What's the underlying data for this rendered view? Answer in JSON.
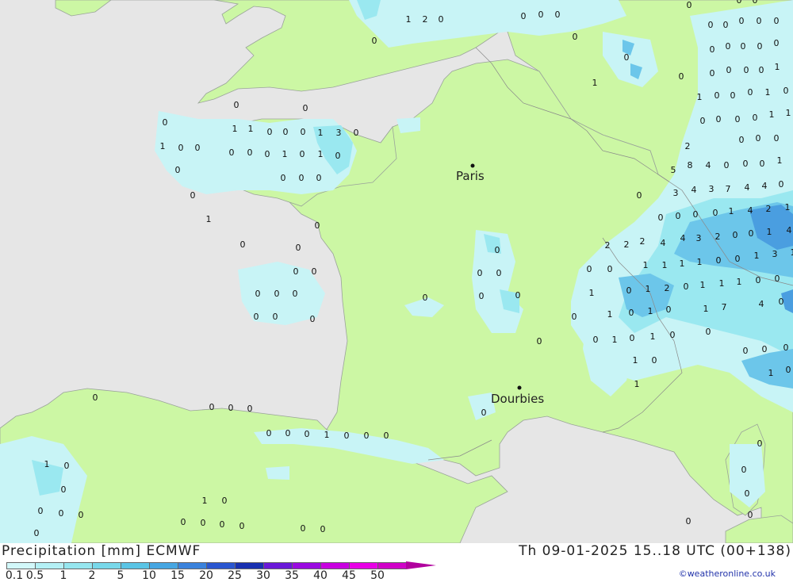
{
  "map": {
    "colors": {
      "sea": "#e6e6e6",
      "land": "#ccf7a4",
      "precip_light": "#c8f4f6",
      "precip_mid": "#9ae8f0",
      "precip_heavy": "#6cc6ea",
      "precip_very_heavy": "#4a9ee0"
    },
    "cities": [
      {
        "name": "Paris"
      },
      {
        "name": "Dourbies"
      }
    ],
    "values": [
      "1",
      "2",
      "0",
      "0",
      "0",
      "0",
      "0",
      "0",
      "1",
      "1",
      "0",
      "0",
      "0",
      "1",
      "3",
      "0",
      "0",
      "0",
      "0",
      "1",
      "0",
      "0",
      "0",
      "0",
      "0",
      "1",
      "0",
      "1",
      "0",
      "0",
      "0",
      "0",
      "0",
      "0",
      "1",
      "0",
      "0",
      "0",
      "0",
      "0",
      "0",
      "0",
      "0",
      "0",
      "0",
      "0",
      "0",
      "0",
      "0",
      "0",
      "0",
      "0",
      "0",
      "0",
      "0",
      "0",
      "0",
      "0",
      "0",
      "0",
      "0",
      "1",
      "0",
      "0",
      "0",
      "1",
      "0",
      "0",
      "0",
      "0",
      "0",
      "1",
      "0",
      "0",
      "0",
      "0",
      "0",
      "0",
      "0",
      "0",
      "0",
      "0",
      "0",
      "0",
      "0",
      "0",
      "0",
      "0",
      "0",
      "0",
      "0",
      "0",
      "0",
      "0",
      "0",
      "0",
      "0",
      "0",
      "0",
      "0",
      "0",
      "0",
      "1",
      "1",
      "0",
      "0",
      "0",
      "1",
      "0",
      "0",
      "0",
      "0",
      "0",
      "1",
      "1",
      "0",
      "0",
      "0",
      "0",
      "0",
      "1",
      "2",
      "5",
      "8",
      "4",
      "0",
      "0",
      "0",
      "1",
      "3",
      "4",
      "3",
      "7",
      "4",
      "4",
      "0",
      "0",
      "0",
      "0",
      "0",
      "0",
      "1",
      "4",
      "2",
      "1",
      "2",
      "4",
      "4",
      "3",
      "2",
      "0",
      "0",
      "1",
      "4",
      "2",
      "2",
      "1",
      "1",
      "1",
      "1",
      "0",
      "0",
      "1",
      "3",
      "1",
      "0",
      "0",
      "0",
      "1",
      "2",
      "0",
      "1",
      "1",
      "1",
      "0",
      "0",
      "1",
      "1",
      "0",
      "1",
      "0",
      "1",
      "7",
      "4",
      "0",
      "0",
      "0",
      "1",
      "0",
      "1",
      "0",
      "0",
      "1",
      "0",
      "1",
      "0",
      "0",
      "0",
      "1",
      "0"
    ]
  },
  "footer": {
    "title": "Precipitation [mm] ECMWF",
    "datetime": "Th 09-01-2025 15..18 UTC (00+138)",
    "credit": "©weatheronline.co.uk"
  },
  "legend": {
    "labels": [
      "0.1",
      "0.5",
      "1",
      "2",
      "5",
      "10",
      "15",
      "20",
      "25",
      "30",
      "35",
      "40",
      "45",
      "50"
    ],
    "colors": [
      "#d2f8fa",
      "#b4f0f5",
      "#96e6ef",
      "#78d8ea",
      "#5ac4e5",
      "#46a6e2",
      "#3a82dc",
      "#2a56d0",
      "#1830b0",
      "#6a18d8",
      "#9a0ae0",
      "#c800e0",
      "#e800e6",
      "#d000c8",
      "#b1009e"
    ]
  }
}
